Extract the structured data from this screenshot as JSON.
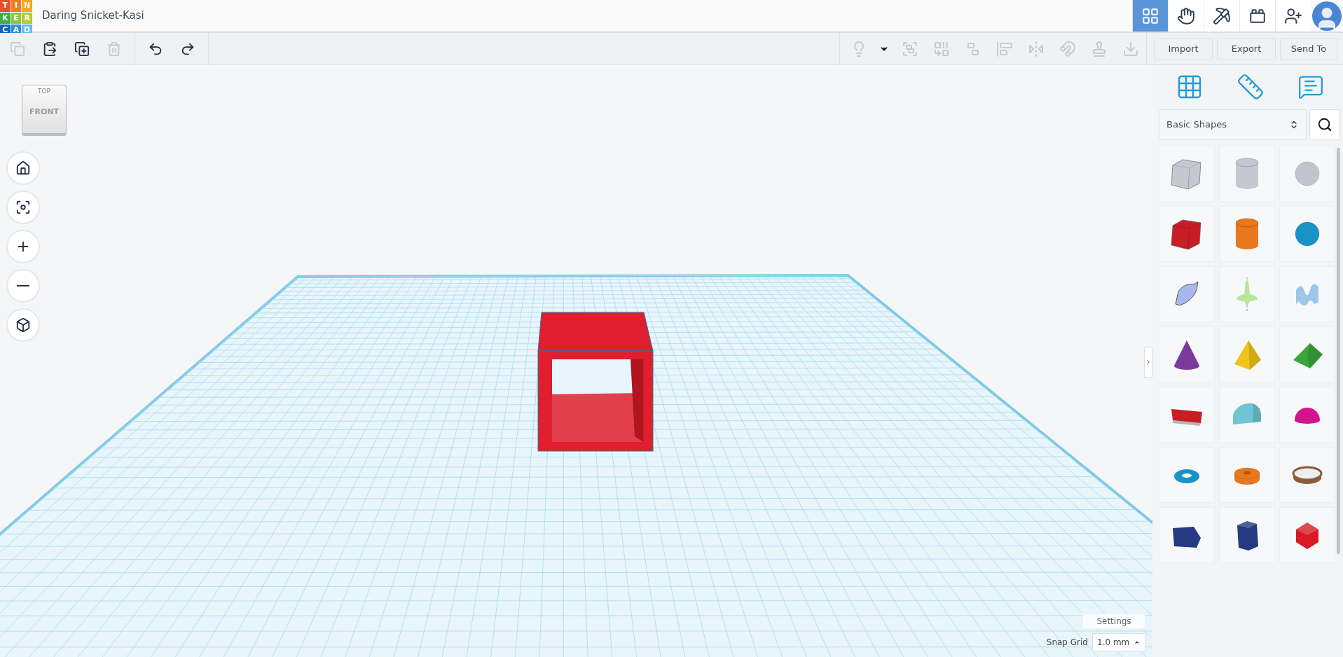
{
  "header": {
    "logo": [
      {
        "letter": "T",
        "color": "#e8502a"
      },
      {
        "letter": "I",
        "color": "#f07d22"
      },
      {
        "letter": "N",
        "color": "#f5a623"
      },
      {
        "letter": "K",
        "color": "#3fae49"
      },
      {
        "letter": "E",
        "color": "#8cc63f"
      },
      {
        "letter": "R",
        "color": "#b5c934"
      },
      {
        "letter": "C",
        "color": "#1565b0"
      },
      {
        "letter": "A",
        "color": "#2d8fd5"
      },
      {
        "letter": "D",
        "color": "#6bb9e6"
      }
    ],
    "title": "Daring Snicket-Kasi"
  },
  "nav": [
    {
      "selected": true
    },
    {
      "selected": false
    },
    {
      "selected": false
    },
    {
      "selected": false
    },
    {
      "selected": false
    }
  ],
  "edit_tools": [
    {
      "disabled": true
    },
    {
      "disabled": false
    },
    {
      "disabled": false
    },
    {
      "disabled": true
    },
    {
      "disabled": false
    },
    {
      "disabled": false
    }
  ],
  "shape_tools": [
    {
      "disabled": true
    },
    {
      "disabled": false
    },
    {
      "disabled": true
    },
    {
      "disabled": true
    },
    {
      "disabled": true
    },
    {
      "disabled": true
    },
    {
      "disabled": true
    },
    {
      "disabled": true
    },
    {
      "disabled": true
    },
    {
      "disabled": true
    }
  ],
  "actions": [
    "Import",
    "Export",
    "Send To"
  ],
  "view_cube": {
    "top": "TOP",
    "front": "FRONT"
  },
  "library": {
    "category": "Basic Shapes"
  },
  "workplane": {
    "settings": "Settings",
    "snap_label": "Snap Grid",
    "snap_value": "1.0 mm"
  }
}
